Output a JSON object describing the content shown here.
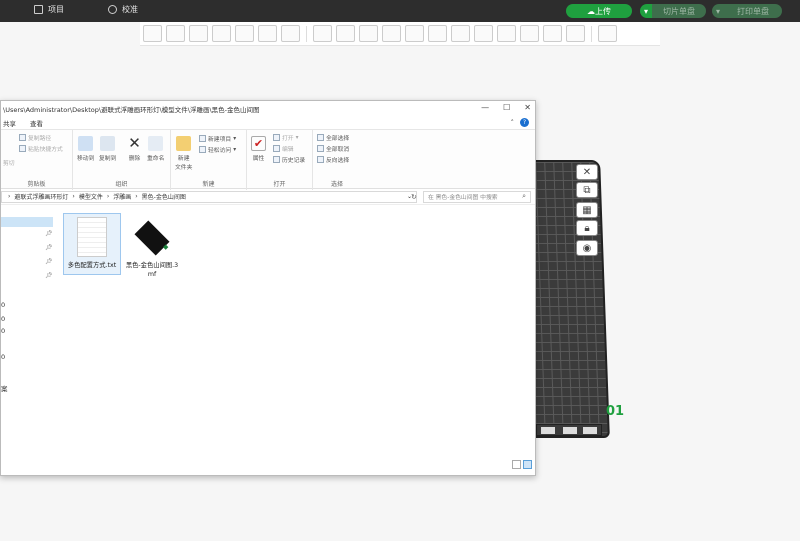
{
  "topbar": {
    "tabs": [
      {
        "label": "项目"
      },
      {
        "label": "校准"
      }
    ],
    "upload_label": "上传",
    "slice_label": "切片单盘",
    "print_label": "打印单盘"
  },
  "plate": {
    "number": "01",
    "buttons": [
      "close-icon",
      "arrange-icon",
      "grid-icon",
      "lock-icon",
      "settings-icon"
    ]
  },
  "explorer": {
    "title": "\\Users\\Administrator\\Desktop\\避联式浮雕画环形灯\\模型文件\\浮雕画\\黑色-金色山间图",
    "controls": {
      "min": "—",
      "max": "☐",
      "close": "✕"
    },
    "menu": [
      "共享",
      "查看"
    ],
    "ribbon": {
      "clipboard": {
        "copy_path": "复制路径",
        "paste_shortcut": "粘贴快捷方式",
        "cut": "剪切",
        "group": "剪贴板"
      },
      "organize": {
        "move_to": "移动到",
        "copy_to": "复制到",
        "delete": "删除",
        "rename": "重命名",
        "group": "组织"
      },
      "new": {
        "new_folder": "新建\n文件夹",
        "new_item": "新建项目",
        "easy_access": "轻松访问",
        "group": "新建"
      },
      "open": {
        "properties": "属性",
        "open": "打开",
        "edit": "编辑",
        "history": "历史记录",
        "group": "打开"
      },
      "select": {
        "select_all": "全部选择",
        "select_none": "全部取消",
        "invert": "反向选择",
        "group": "选择"
      }
    },
    "address": [
      "避联式浮雕画环形灯",
      "模型文件",
      "浮雕画",
      "黑色-金色山间图"
    ],
    "search_placeholder": "在 黑色-金色山间图 中搜索",
    "nav_fragments": [
      "0",
      "0",
      "0",
      "0",
      "案"
    ],
    "files": [
      {
        "name": "多色配置方式.txt",
        "icon": "text-file-icon"
      },
      {
        "name": "黑色-金色山间图.3mf",
        "icon": "3mf-file-icon"
      }
    ]
  }
}
